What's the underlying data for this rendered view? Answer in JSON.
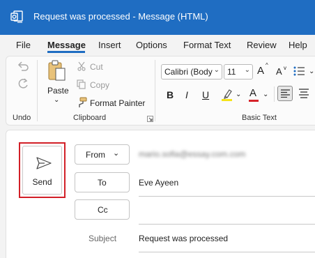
{
  "window": {
    "title": "Request was processed  -  Message (HTML)",
    "accent": "#1f6dc2"
  },
  "menu": {
    "tabs": [
      "File",
      "Message",
      "Insert",
      "Options",
      "Format Text",
      "Review",
      "Help"
    ],
    "active": "Message"
  },
  "ribbon": {
    "undo": {
      "group_label": "Undo"
    },
    "clipboard": {
      "paste": "Paste",
      "cut": "Cut",
      "copy": "Copy",
      "format_painter": "Format Painter",
      "group_label": "Clipboard"
    },
    "basic_text": {
      "font_name": "Calibri (Body",
      "font_size": "11",
      "bold": "B",
      "italic": "I",
      "underline": "U",
      "font_color_letter": "A",
      "grow_font": "A",
      "shrink_font": "A",
      "group_label": "Basic Text"
    }
  },
  "compose": {
    "send_label": "Send",
    "from_label": "From",
    "from_value": "mario.sofia@essay.com.com",
    "to_label": "To",
    "to_value": "Eve Ayeen",
    "cc_label": "Cc",
    "subject_label": "Subject",
    "subject_value": "Request was processed"
  },
  "colors": {
    "highlight": "#f5e31a",
    "font_color": "#d6232a",
    "send_outline": "#d21f27"
  }
}
